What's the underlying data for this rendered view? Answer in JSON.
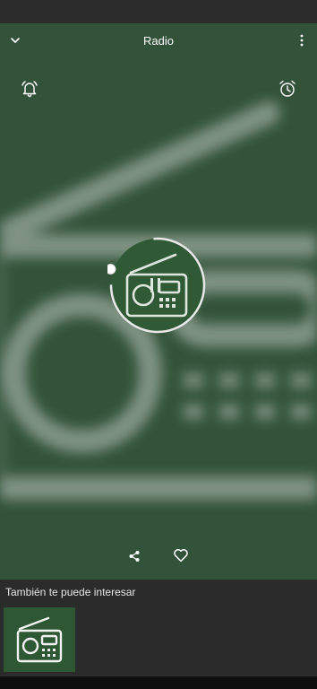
{
  "header": {
    "title": "Radio",
    "collapse_icon": "chevron-down-icon",
    "menu_icon": "more-vertical-icon"
  },
  "player": {
    "background_color": "#32533a",
    "accent_color": "#ffffff",
    "ring_color": "#e8e8e8",
    "alarm_icon": "bell-icon",
    "timer_icon": "alarm-clock-icon",
    "cover_icon": "radio-icon",
    "share_icon": "share-icon",
    "favorite_icon": "heart-icon"
  },
  "recommendations": {
    "title": "También te puede interesar",
    "items": [
      {
        "icon": "radio-icon",
        "background_color": "#2e5733"
      }
    ]
  }
}
